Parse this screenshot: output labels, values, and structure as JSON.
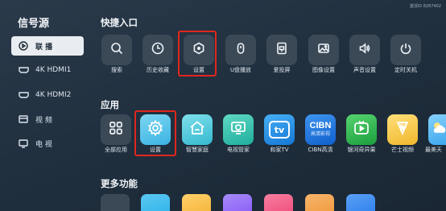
{
  "top_right_text": "激活ID 8267402",
  "sidebar": {
    "title": "信号源",
    "items": [
      {
        "label": "联 播",
        "icon": "play-icon",
        "active": true
      },
      {
        "label": "4K HDMI1",
        "icon": "hdmi-icon",
        "active": false
      },
      {
        "label": "4K HDMI2",
        "icon": "hdmi-icon",
        "active": false
      },
      {
        "label": "视 频",
        "icon": "video-icon",
        "active": false
      },
      {
        "label": "电 视",
        "icon": "tv-icon",
        "active": false
      }
    ]
  },
  "quick_entry": {
    "title": "快捷入口",
    "items": [
      {
        "label": "搜索",
        "icon": "search-icon"
      },
      {
        "label": "历史收藏",
        "icon": "clock-icon"
      },
      {
        "label": "设置",
        "icon": "settings-hex-icon",
        "highlighted": true
      },
      {
        "label": "U盘播放",
        "icon": "usb-icon"
      },
      {
        "label": "爱投屏",
        "icon": "cast-icon"
      },
      {
        "label": "图像设置",
        "icon": "image-icon"
      },
      {
        "label": "声音设置",
        "icon": "speaker-icon"
      },
      {
        "label": "定时关机",
        "icon": "power-icon"
      }
    ]
  },
  "apps": {
    "title": "应用",
    "items": [
      {
        "label": "全部应用",
        "icon": "grid-icon",
        "color": "#3b4957"
      },
      {
        "label": "设置",
        "icon": "gear-icon",
        "color": "#58c6e8",
        "highlighted": true
      },
      {
        "label": "智慧家庭",
        "icon": "smart-home-icon",
        "color": "#4ec7d9"
      },
      {
        "label": "电视管家",
        "icon": "tv-manager-icon",
        "color": "#2bbfae"
      },
      {
        "label": "和家TV",
        "icon": "hejia-tv-icon",
        "color": "#1f8ee0",
        "logo_text": "tv"
      },
      {
        "label": "CIBN高清",
        "icon": "cibn-icon",
        "color": "#1877e6",
        "logo_text": "CIBN",
        "logo_sub": "高清影视"
      },
      {
        "label": "银河奇异果",
        "icon": "kiwi-tv-icon",
        "color": "#22b14c"
      },
      {
        "label": "芒士视频",
        "icon": "video-app-icon",
        "color": "#f2c94c"
      },
      {
        "label": "最美天",
        "icon": "weather-icon",
        "color": "#58b7f0"
      }
    ]
  },
  "more": {
    "title": "更多功能",
    "colors": [
      "#3b4957",
      "#2fb4ea",
      "#f4b43a",
      "#8b5cf6",
      "#ef4d7a",
      "#f19a3e",
      "#2f80ed"
    ]
  }
}
